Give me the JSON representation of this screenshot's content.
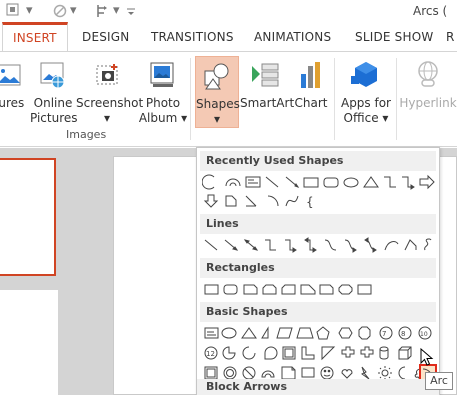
{
  "window": {
    "title": "Arcs ("
  },
  "tabs": [
    {
      "label": "INSERT",
      "active": true
    },
    {
      "label": "DESIGN"
    },
    {
      "label": "TRANSITIONS"
    },
    {
      "label": "ANIMATIONS"
    },
    {
      "label": "SLIDE SHOW"
    },
    {
      "label": "R"
    }
  ],
  "ribbon": {
    "images": {
      "group_label": "Images",
      "pictures": "tures",
      "online_pictures_1": "Online",
      "online_pictures_2": "Pictures",
      "screenshot": "Screenshot",
      "screenshot_arrow": "▾",
      "photo_album_1": "Photo",
      "photo_album_2": "Album",
      "photo_album_arrow": "▾"
    },
    "illustrations": {
      "shapes": "Shapes",
      "shapes_arrow": "▾",
      "smartart": "SmartArt",
      "chart": "Chart"
    },
    "apps": {
      "apps_1": "Apps for",
      "apps_2": "Office",
      "apps_arrow": "▾"
    },
    "links": {
      "hyperlink": "Hyperlink"
    }
  },
  "gallery": {
    "sections": {
      "recent": "Recently Used Shapes",
      "lines": "Lines",
      "rectangles": "Rectangles",
      "basic": "Basic Shapes",
      "block_arrows": "Block Arrows"
    },
    "basic_row2_labels": {
      "twelve": "12",
      "ten": "10",
      "eight": "8"
    },
    "recent_brace": "{"
  },
  "tooltip": {
    "text": "Arc"
  },
  "colors": {
    "accent": "#d04423",
    "ribbon_active": "#f4c9b4",
    "apps_blue": "#1c6ed4",
    "selection_border": "#e02a1a"
  }
}
